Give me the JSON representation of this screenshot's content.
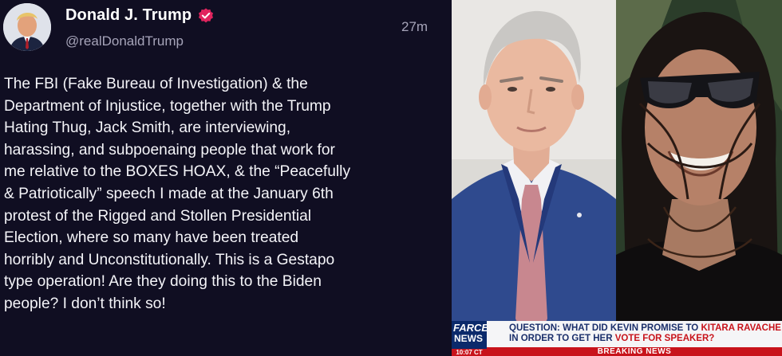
{
  "post": {
    "author": {
      "display_name": "Donald J. Trump",
      "handle": "@realDonaldTrump",
      "verified": true,
      "avatar_icon": "profile-photo"
    },
    "timestamp": "27m",
    "body": "The FBI (Fake Bureau of Investigation) & the\nDepartment of Injustice, together with the Trump\nHating Thug, Jack Smith, are interviewing,\nharassing, and subpoenaing people that work for\nme relative to the BOXES HOAX, & the “Peacefully\n& Patriotically” speech I made at the January 6th\nprotest of the Rigged and Stollen Presidential\nElection, where so many have been treated\nhorribly and Unconstitutionally. This is a Gestapo\ntype operation! Are they doing this to the Biden\npeople? I don’t think so!"
  },
  "news_graphic": {
    "logo_top": "FARCE",
    "logo_main": "NEWS",
    "logo_time": "10:07 CT",
    "headline_line1_a": "QUESTION: WHAT DID KEVIN PROMISE TO ",
    "headline_line1_b": "KITARA RAVACHE",
    "headline_line2_a": "IN ORDER TO GET HER ",
    "headline_line2_b": "VOTE FOR SPEAKER?",
    "banner": "BREAKING NEWS"
  },
  "colors": {
    "background": "#100e22",
    "verified_badge": "#e0245e",
    "news_blue": "#1b2f6b",
    "news_red": "#c8131b"
  }
}
